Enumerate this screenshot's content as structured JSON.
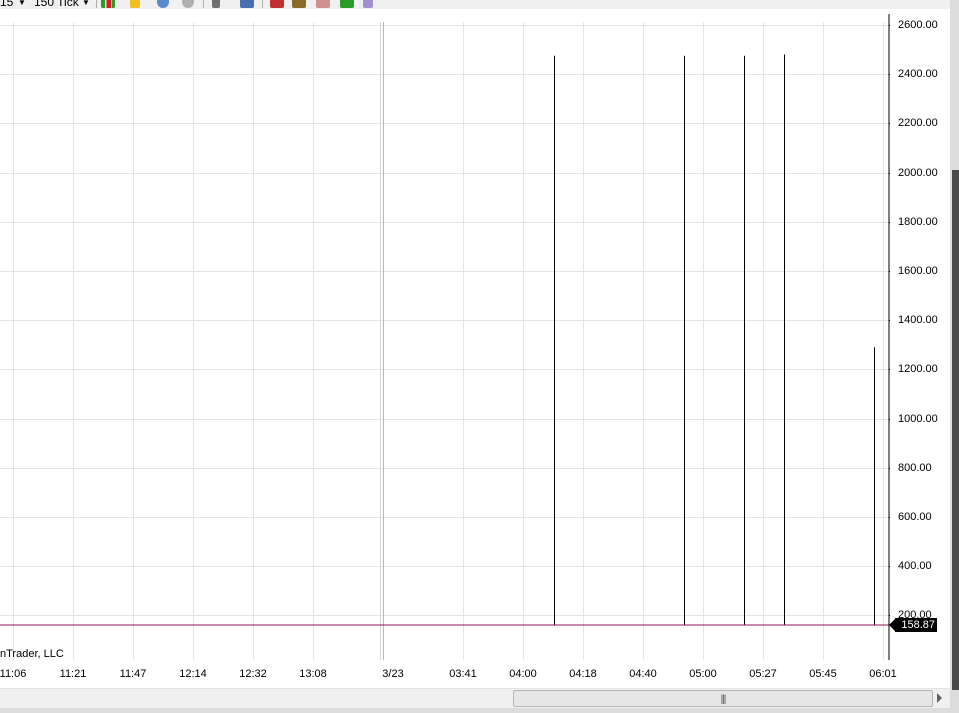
{
  "toolbar": {
    "instrument_fragment": "15",
    "interval_label": "150 Tick"
  },
  "colors": {
    "grid": "#e4e4e4",
    "price_line": "#8b1a5a",
    "bars": "#000000",
    "price_tag_bg": "#000000",
    "price_tag_text": "#ffffff"
  },
  "chart": {
    "copyright": "nTrader, LLC",
    "current_price": "158.87",
    "scrollbar_grip": "|||"
  },
  "chart_data": {
    "type": "bar",
    "y_axis_labels": [
      "2600.00",
      "2400.00",
      "2200.00",
      "2000.00",
      "1800.00",
      "1600.00",
      "1400.00",
      "1200.00",
      "1000.00",
      "800.00",
      "600.00",
      "400.00",
      "200.00"
    ],
    "x_axis_labels": [
      "11:06",
      "11:21",
      "11:47",
      "12:14",
      "12:32",
      "13:08",
      "3/23",
      "03:41",
      "04:00",
      "04:18",
      "04:40",
      "05:00",
      "05:27",
      "05:45",
      "06:01"
    ],
    "ylim": [
      0,
      2640
    ],
    "current_value": 158.87,
    "spikes": [
      {
        "near": "04:18",
        "low": 158.87,
        "high": 2475
      },
      {
        "near": "05:00",
        "low": 158.87,
        "high": 2475
      },
      {
        "near": "05:27",
        "low": 158.87,
        "high": 2475
      },
      {
        "near": "05:27",
        "low": 158.87,
        "high": 2480
      },
      {
        "near": "06:01",
        "low": 158.87,
        "high": 1290
      }
    ],
    "grid": true
  }
}
